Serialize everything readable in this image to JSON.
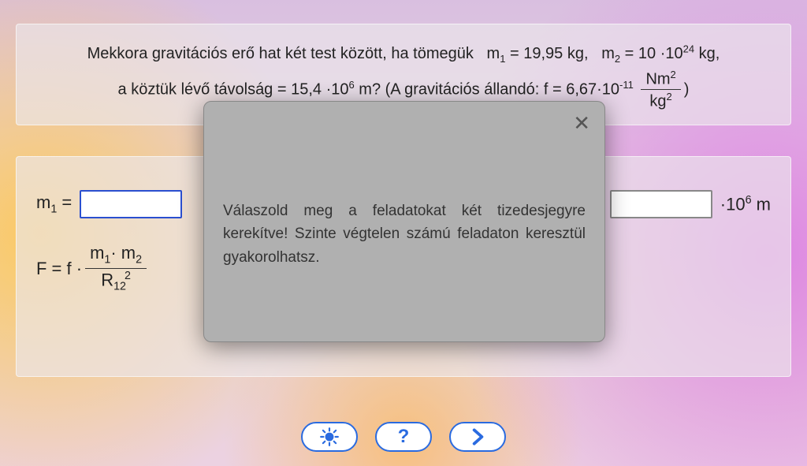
{
  "problem": {
    "line1_prefix": "Mekkora gravitációs erő hat két test között, ha tömegük",
    "m1_label": "m",
    "m1_sub": "1",
    "m1_eq": " = 19,95 kg,",
    "m2_label": "m",
    "m2_sub": "2",
    "m2_eq_a": " = 10 ·10",
    "m2_exp": "24",
    "m2_eq_b": " kg,",
    "line2_a": "a köztük lévő távolság = 15,4 ·10",
    "dist_exp": "6",
    "line2_b": " m?   (A gravitációs állandó: f =  6,67·10",
    "f_exp": "-11",
    "frac_num_a": "Nm",
    "frac_num_exp": "2",
    "frac_den_a": "kg",
    "frac_den_exp": "2",
    "line2_end": ")"
  },
  "answers": {
    "m1_lhs_a": "m",
    "m1_lhs_sub": "1",
    "m1_lhs_b": " = ",
    "r12_unit_a": " ·10",
    "r12_unit_exp": "6",
    "r12_unit_b": " m",
    "formula_a": "F = f · ",
    "formula_num_a": "m",
    "formula_num_sub1": "1",
    "formula_num_mid": "· m",
    "formula_num_sub2": "2",
    "formula_den_a": "R",
    "formula_den_sub": "12",
    "formula_den_exp": "2"
  },
  "modal": {
    "text": "Válaszold meg a feladatokat két tizedesjegyre kerekítve! Szinte végtelen számú feladaton keresztül gyakorolhatsz."
  }
}
